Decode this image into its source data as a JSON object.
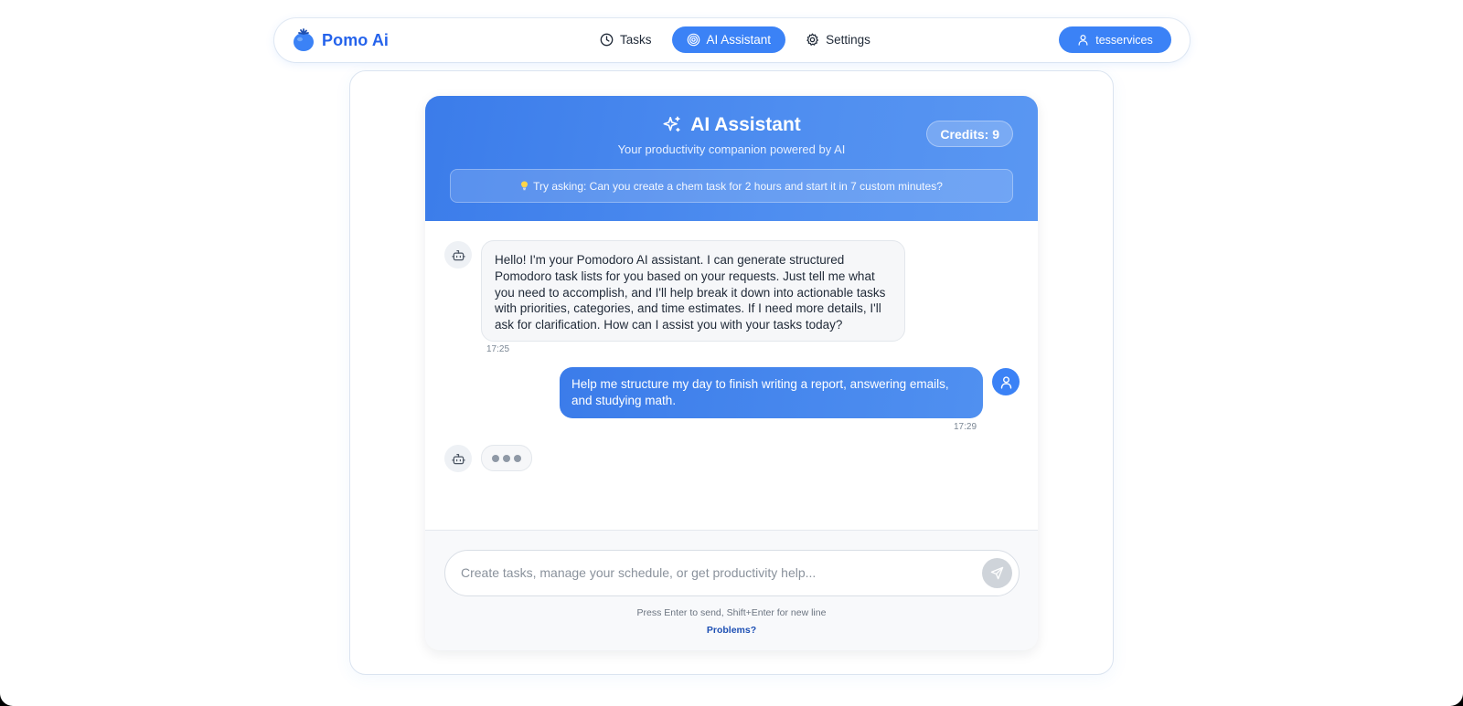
{
  "navbar": {
    "brand": "Pomo Ai",
    "links": [
      {
        "label": "Tasks",
        "icon": "clock-icon",
        "active": false
      },
      {
        "label": "AI Assistant",
        "icon": "target-icon",
        "active": true
      },
      {
        "label": "Settings",
        "icon": "gear-icon",
        "active": false
      }
    ],
    "user": "tesservices"
  },
  "header": {
    "title": "AI Assistant",
    "subtitle": "Your productivity companion powered by AI",
    "credits": "Credits: 9",
    "tip": "Try asking: Can you create a chem task for 2 hours and start it in 7 custom minutes?"
  },
  "messages": [
    {
      "role": "assistant",
      "text": "Hello! I'm your Pomodoro AI assistant. I can generate structured Pomodoro task lists for you based on your requests. Just tell me what you need to accomplish, and I'll help break it down into actionable tasks with priorities, categories, and time estimates. If I need more details, I'll ask for clarification. How can I assist you with your tasks today?",
      "time": "17:25"
    },
    {
      "role": "user",
      "text": "Help me structure my day to finish writing a report, answering emails, and studying math.",
      "time": "17:29"
    }
  ],
  "composer": {
    "placeholder": "Create tasks, manage your schedule, or get productivity help...",
    "value": "",
    "hint": "Press Enter to send, Shift+Enter for new line",
    "problems": "Problems?"
  },
  "colors": {
    "accent": "#3b82f6",
    "brand": "#2563eb",
    "header_gradient_start": "#3b7cea",
    "header_gradient_end": "#5a97f2"
  }
}
